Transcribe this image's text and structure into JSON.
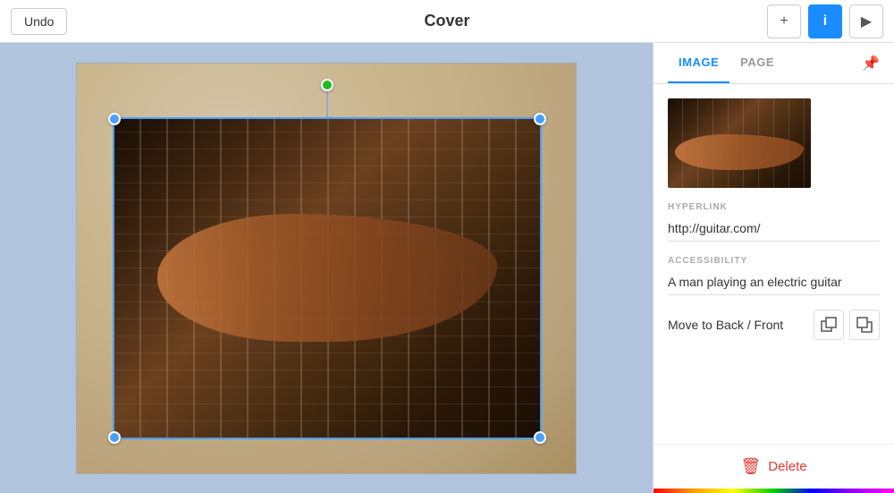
{
  "toolbar": {
    "undo_label": "Undo",
    "title": "Cover",
    "btn_add_label": "+",
    "btn_info_label": "i",
    "btn_play_label": "▶"
  },
  "panel": {
    "tab_image": "IMAGE",
    "tab_page": "PAGE",
    "sections": {
      "hyperlink_label": "HYPERLINK",
      "hyperlink_value": "http://guitar.com/",
      "accessibility_label": "ACCESSIBILITY",
      "accessibility_value": "A man playing an electric guitar",
      "move_label": "Move to Back / Front"
    },
    "delete_label": "Delete"
  }
}
